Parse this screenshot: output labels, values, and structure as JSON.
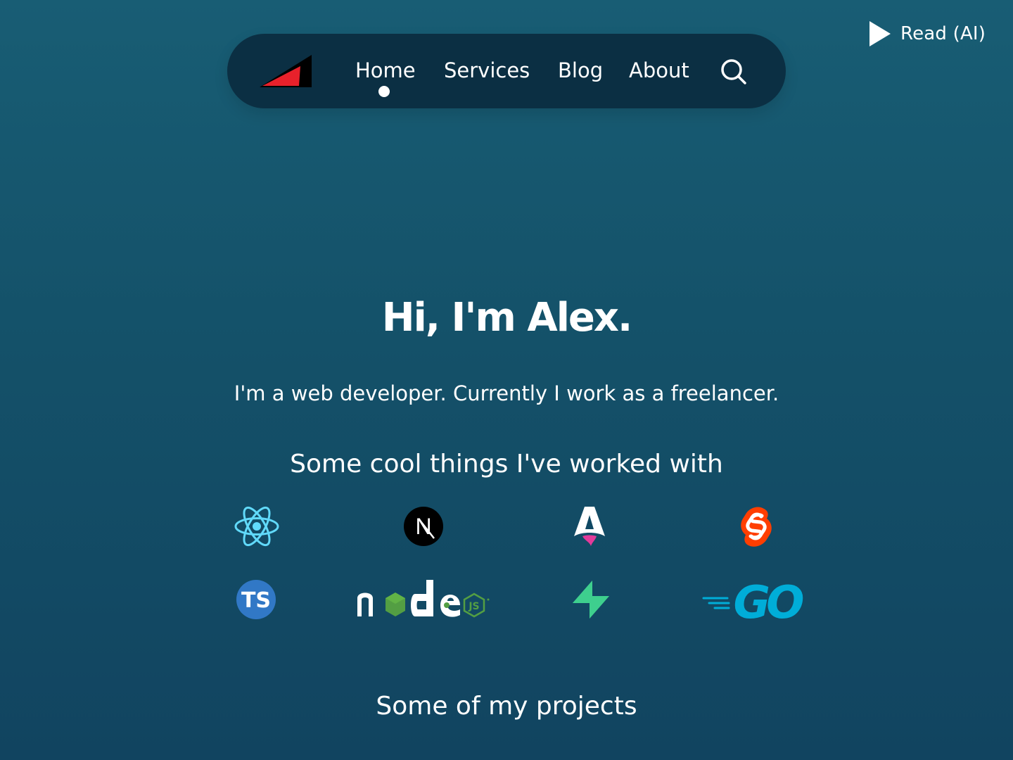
{
  "read_ai": {
    "label": "Read (AI)"
  },
  "nav": {
    "items": [
      {
        "label": "Home",
        "active": true
      },
      {
        "label": "Services"
      },
      {
        "label": "Blog"
      },
      {
        "label": "About"
      }
    ],
    "search_icon": "search-icon"
  },
  "hero": {
    "title": "Hi, I'm Alex.",
    "subtitle": "I'm a web developer. Currently I work as a freelancer."
  },
  "tools": {
    "title": "Some cool things I've worked with",
    "items": [
      {
        "icon": "react-icon",
        "text": ""
      },
      {
        "icon": "nextjs-icon",
        "text": "N"
      },
      {
        "icon": "astro-icon",
        "text": ""
      },
      {
        "icon": "svelte-icon",
        "text": ""
      },
      {
        "icon": "typescript-icon",
        "text": "TS"
      },
      {
        "icon": "nodejs-icon",
        "text": "JS"
      },
      {
        "icon": "supabase-icon",
        "text": ""
      },
      {
        "icon": "go-icon",
        "text": "GO"
      }
    ]
  },
  "projects": {
    "title": "Some of my projects"
  },
  "colors": {
    "background_top": "#185d74",
    "background_bottom": "#114460",
    "navbar": "#0b2f43",
    "logo_red": "#e8212b",
    "react": "#61dafb",
    "typescript": "#3178c6",
    "svelte": "#ff3e00",
    "node_green": "#539e43",
    "supabase": "#3ecf8e",
    "go": "#00add8"
  }
}
